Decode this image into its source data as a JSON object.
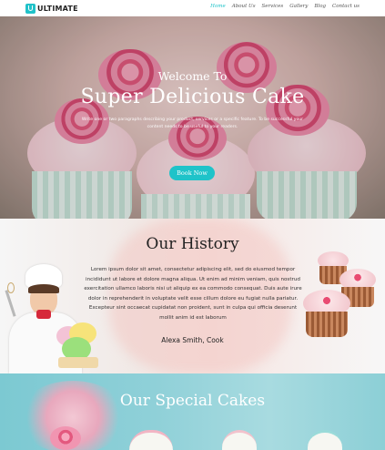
{
  "brand": {
    "name": "ULTIMATE"
  },
  "nav": {
    "items": [
      {
        "label": "Home",
        "active": true
      },
      {
        "label": "About Us"
      },
      {
        "label": "Services"
      },
      {
        "label": "Gallery"
      },
      {
        "label": "Blog"
      },
      {
        "label": "Contact us"
      }
    ]
  },
  "hero": {
    "subtitle": "Welcome To",
    "title": "Super Delicious Cake",
    "description_line1": "Write one or two paragraphs describing your product, services or a specific feature. To be successful your",
    "description_line2": "content needs to be useful to your readers.",
    "button_label": "Book Now"
  },
  "history": {
    "title": "Our History",
    "lines": [
      "Lorem ipsum dolor sit amet, consectetur adipiscing elit, sed do eiusmod tempor",
      "incididunt ut labore et dolore magna aliqua. Ut enim ad minim veniam, quis nostrud",
      "exercitation ullamco laboris nisi ut aliquip ex ea commodo consequat. Duis aute irure",
      "dolor in reprehenderit in voluptate velit esse cillum dolore eu fugiat nulla pariatur.",
      "Excepteur sint occaecat cupidatat non proident, sunt in culpa qui officia deserunt",
      "mollit anim id est laborum"
    ],
    "signature": "Alexa Smith, Cook"
  },
  "special": {
    "title": "Our Special Cakes"
  },
  "colors": {
    "accent": "#1fc3c9",
    "heading": "#222222",
    "special_bg": "#8fd0d8"
  }
}
